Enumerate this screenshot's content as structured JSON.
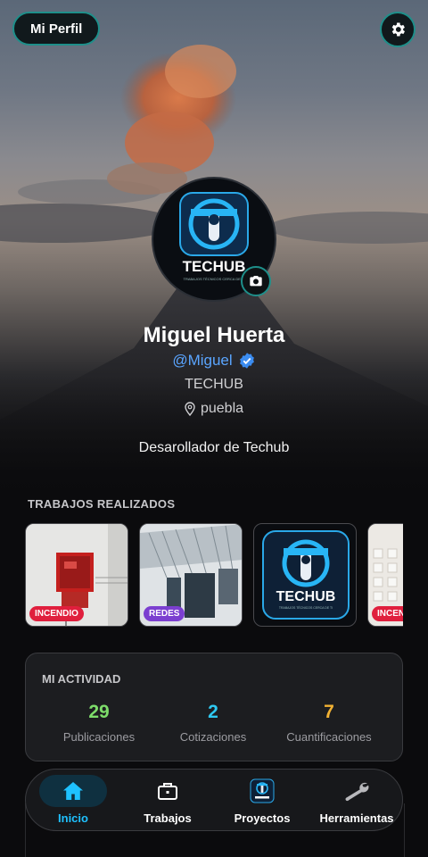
{
  "header": {
    "profile_button": "Mi Perfil",
    "settings_icon": "gear-icon"
  },
  "profile": {
    "name": "Miguel Huerta",
    "handle": "@Miguel",
    "verified_icon": "verified-badge-icon",
    "company": "TECHUB",
    "location": "puebla",
    "location_icon": "map-pin-icon",
    "bio": "Desarollador de Techub",
    "avatar_logo_text": "TECHUB",
    "avatar_logo_subtext": "TRABAJOS TÉCNICOS CERCA DE TI",
    "camera_icon": "camera-icon"
  },
  "works": {
    "title": "TRABAJOS REALIZADOS",
    "items": [
      {
        "tag": "INCENDIO",
        "tag_color": "#e01f3d"
      },
      {
        "tag": "REDES",
        "tag_color": "#7b3fd0"
      },
      {
        "tag": "",
        "logo_text": "TECHUB",
        "logo_subtext": "TRABAJOS TÉCNICOS CERCA DE TI"
      },
      {
        "tag": "INCENDIO",
        "tag_color": "#e01f3d"
      }
    ]
  },
  "activity": {
    "title": "MI ACTIVIDAD",
    "stats": [
      {
        "value": "29",
        "label": "Publicaciones",
        "color": "#7ddc6a"
      },
      {
        "value": "2",
        "label": "Cotizaciones",
        "color": "#2ec8f0"
      },
      {
        "value": "7",
        "label": "Cuantificaciones",
        "color": "#f2b233"
      }
    ]
  },
  "nav": {
    "active": "Inicio",
    "accent": "#1ec1ff",
    "items": [
      {
        "label": "Inicio",
        "icon": "home-icon"
      },
      {
        "label": "Trabajos",
        "icon": "briefcase-icon"
      },
      {
        "label": "Proyectos",
        "icon": "techub-logo-icon"
      },
      {
        "label": "Herramientas",
        "icon": "wrench-icon"
      }
    ]
  }
}
